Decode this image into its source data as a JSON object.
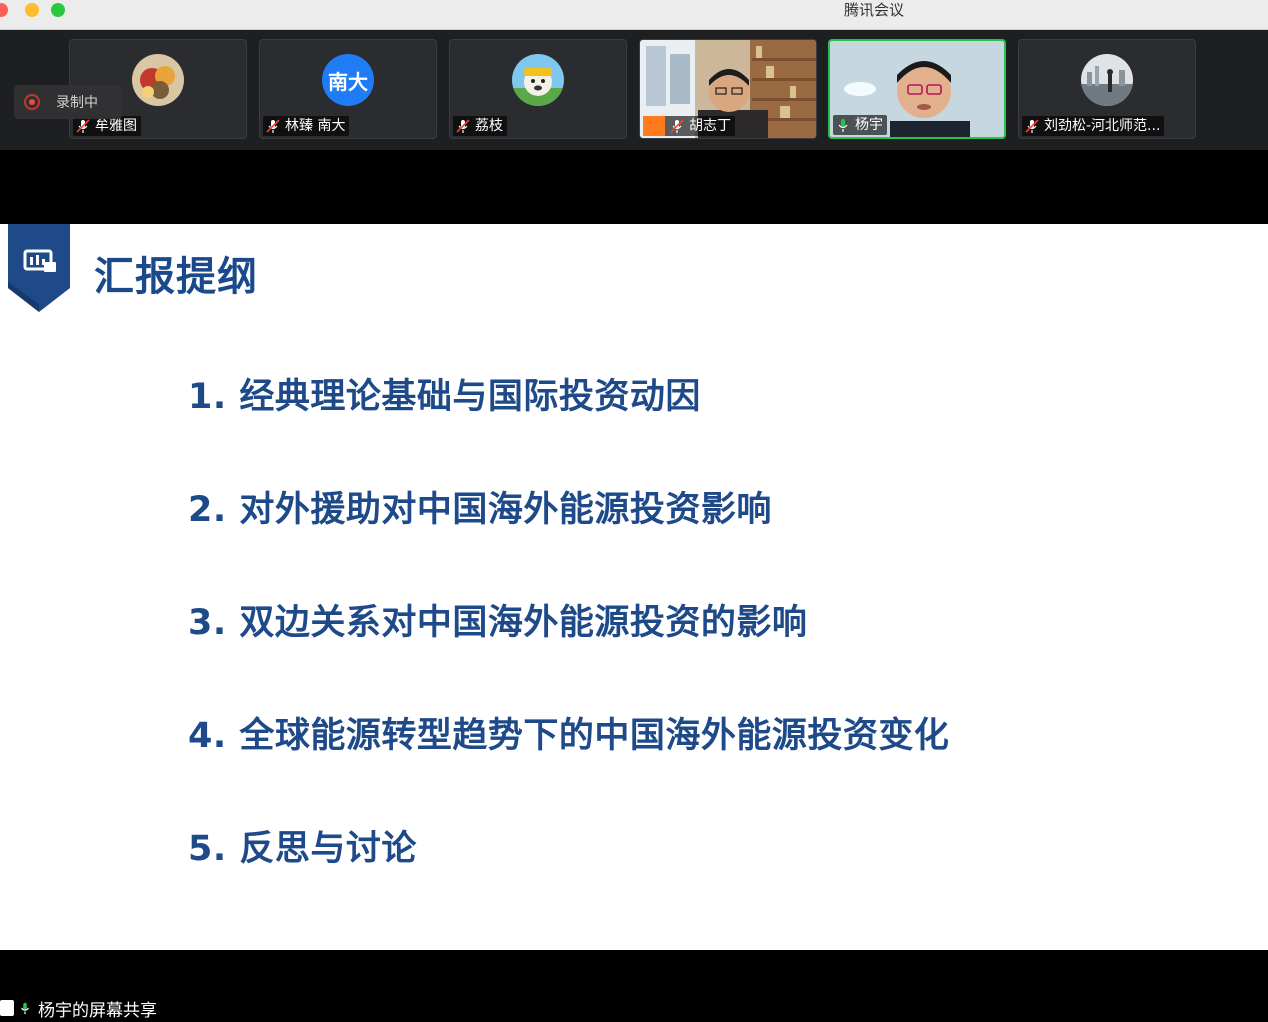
{
  "app": {
    "title": "腾讯会议"
  },
  "recording": {
    "label": "录制中"
  },
  "participants": [
    {
      "name": "牟雅图",
      "type": "photo",
      "active": false
    },
    {
      "name": "林臻 南大",
      "type": "text",
      "avatar_text": "南大",
      "active": false
    },
    {
      "name": "荔枝",
      "type": "photo",
      "active": false
    },
    {
      "name": "胡志丁",
      "type": "video",
      "active": false
    },
    {
      "name": "杨宇",
      "type": "video",
      "active": true
    },
    {
      "name": "刘劲松-河北师范...",
      "type": "photo",
      "active": false
    }
  ],
  "slide": {
    "title": "汇报提纲",
    "items": [
      "1. 经典理论基础与国际投资动因",
      "2. 对外援助对中国海外能源投资影响",
      "3. 双边关系对中国海外能源投资的影响",
      "4. 全球能源转型趋势下的中国海外能源投资变化",
      "5. 反思与讨论"
    ]
  },
  "share": {
    "label": "杨宇的屏幕共享"
  },
  "colors": {
    "accent": "#1e4a8a",
    "active_border": "#27c24c",
    "avatar_blue": "#1f7cf5"
  }
}
